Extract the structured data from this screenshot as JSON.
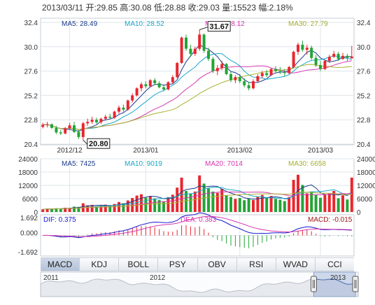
{
  "header": {
    "date": "2013/03/11",
    "items": [
      {
        "label": "开",
        "value": "29.85"
      },
      {
        "label": "高",
        "value": "30.08"
      },
      {
        "label": "低",
        "value": "28.88"
      },
      {
        "label": "收",
        "value": "29.03"
      },
      {
        "label": "量",
        "value": "15523"
      },
      {
        "label": "幅",
        "value": "2.18%"
      }
    ]
  },
  "colors": {
    "up": "#e8262e",
    "down": "#23a435",
    "ma5": "#1a3a8c",
    "ma10": "#18a8c8",
    "ma20": "#d836b0",
    "ma30": "#a8b030",
    "grid": "#dfe4ea",
    "frame": "#c6ccd5",
    "dif": "#1a1ad0",
    "dea": "#d836b0"
  },
  "tabs": [
    "MACD",
    "KDJ",
    "BOLL",
    "PSY",
    "OBV",
    "RSI",
    "WVAD",
    "CCI"
  ],
  "active_tab": "MACD",
  "chart_data": [
    {
      "type": "candlestick",
      "ma_legend": [
        {
          "name": "MA5",
          "value": "28.49"
        },
        {
          "name": "MA10",
          "value": "28.52"
        },
        {
          "name": "MA20",
          "value": "28.12"
        },
        {
          "name": "MA30",
          "value": "27.79"
        }
      ],
      "y_ticks": [
        "32.4",
        "30.0",
        "27.6",
        "25.2",
        "22.8",
        "20.4"
      ],
      "ylim": [
        20.4,
        32.4
      ],
      "x_ticks": [
        {
          "label": "2012/12",
          "index": 6
        },
        {
          "label": "2013/01",
          "index": 23
        },
        {
          "label": "2013/02",
          "index": 44
        },
        {
          "label": "2013/03",
          "index": 62
        }
      ],
      "annotations": [
        {
          "text": "31.67",
          "index": 35,
          "price": 31.67
        },
        {
          "text": "20.80",
          "index": 9,
          "price": 20.8
        }
      ],
      "ohlc": [
        [
          22.1,
          22.5,
          21.95,
          22.3
        ],
        [
          22.3,
          22.6,
          22.05,
          22.35
        ],
        [
          22.35,
          22.45,
          21.9,
          22.0
        ],
        [
          22.0,
          22.2,
          21.4,
          21.55
        ],
        [
          21.55,
          21.8,
          21.3,
          21.45
        ],
        [
          21.45,
          22.1,
          21.35,
          21.95
        ],
        [
          21.95,
          22.5,
          21.8,
          22.25
        ],
        [
          22.25,
          22.6,
          21.5,
          21.6
        ],
        [
          21.6,
          21.8,
          20.9,
          21.1
        ],
        [
          21.1,
          22.6,
          20.8,
          22.45
        ],
        [
          22.45,
          22.9,
          22.2,
          22.6
        ],
        [
          22.6,
          23.1,
          22.4,
          22.8
        ],
        [
          22.8,
          23.0,
          22.4,
          22.55
        ],
        [
          22.55,
          23.0,
          22.4,
          22.9
        ],
        [
          22.9,
          23.3,
          22.7,
          23.1
        ],
        [
          23.1,
          23.4,
          22.9,
          23.0
        ],
        [
          23.0,
          23.7,
          22.9,
          23.6
        ],
        [
          23.6,
          24.2,
          23.4,
          24.0
        ],
        [
          24.0,
          24.3,
          23.6,
          23.8
        ],
        [
          23.8,
          24.8,
          23.7,
          24.7
        ],
        [
          24.7,
          25.4,
          24.5,
          25.2
        ],
        [
          25.2,
          26.0,
          25.1,
          25.9
        ],
        [
          25.9,
          26.5,
          25.6,
          26.3
        ],
        [
          26.3,
          26.6,
          25.9,
          26.1
        ],
        [
          26.1,
          26.8,
          26.0,
          26.7
        ],
        [
          26.7,
          26.9,
          26.2,
          26.4
        ],
        [
          26.4,
          26.6,
          25.9,
          26.0
        ],
        [
          26.0,
          26.3,
          25.6,
          25.8
        ],
        [
          25.8,
          26.6,
          25.7,
          26.5
        ],
        [
          26.5,
          27.2,
          26.3,
          27.0
        ],
        [
          27.0,
          28.5,
          26.9,
          28.4
        ],
        [
          28.4,
          31.0,
          28.3,
          30.9
        ],
        [
          30.9,
          31.2,
          29.6,
          29.8
        ],
        [
          29.8,
          30.2,
          29.0,
          29.3
        ],
        [
          29.3,
          30.0,
          29.1,
          29.8
        ],
        [
          29.8,
          31.67,
          29.6,
          31.2
        ],
        [
          31.2,
          31.3,
          29.4,
          29.6
        ],
        [
          29.6,
          29.9,
          28.6,
          28.8
        ],
        [
          28.8,
          29.0,
          27.4,
          27.6
        ],
        [
          27.6,
          28.2,
          27.2,
          27.9
        ],
        [
          27.9,
          28.6,
          27.7,
          28.3
        ],
        [
          28.3,
          28.4,
          27.2,
          27.3
        ],
        [
          27.3,
          27.5,
          26.5,
          26.7
        ],
        [
          26.7,
          27.2,
          26.4,
          27.0
        ],
        [
          27.0,
          27.3,
          26.4,
          26.6
        ],
        [
          26.6,
          26.9,
          26.0,
          26.2
        ],
        [
          26.2,
          26.5,
          25.7,
          25.9
        ],
        [
          25.9,
          26.8,
          25.8,
          26.6
        ],
        [
          26.6,
          27.3,
          26.5,
          27.1
        ],
        [
          27.1,
          27.6,
          26.9,
          27.4
        ],
        [
          27.4,
          27.7,
          27.0,
          27.2
        ],
        [
          27.2,
          27.9,
          27.1,
          27.8
        ],
        [
          27.8,
          28.1,
          27.4,
          27.6
        ],
        [
          27.6,
          28.0,
          27.3,
          27.5
        ],
        [
          27.5,
          27.8,
          27.1,
          27.4
        ],
        [
          27.4,
          28.1,
          27.3,
          28.0
        ],
        [
          28.0,
          29.6,
          27.9,
          29.5
        ],
        [
          29.5,
          30.4,
          29.2,
          30.2
        ],
        [
          30.2,
          30.6,
          29.5,
          29.7
        ],
        [
          29.7,
          30.2,
          29.2,
          29.9
        ],
        [
          29.9,
          30.1,
          28.7,
          28.9
        ],
        [
          28.9,
          29.2,
          28.0,
          28.2
        ],
        [
          28.2,
          28.6,
          27.6,
          27.8
        ],
        [
          27.8,
          28.7,
          27.7,
          28.6
        ],
        [
          28.6,
          29.2,
          28.4,
          29.0
        ],
        [
          29.0,
          29.6,
          28.9,
          29.3
        ],
        [
          29.3,
          29.5,
          28.6,
          28.8
        ],
        [
          28.8,
          29.4,
          28.7,
          29.1
        ],
        [
          29.1,
          29.3,
          28.6,
          28.9
        ],
        [
          28.85,
          30.08,
          28.88,
          29.03
        ]
      ]
    },
    {
      "type": "bar",
      "ma_legend": [
        {
          "name": "MA5",
          "value": "7425"
        },
        {
          "name": "MA10",
          "value": "9019"
        },
        {
          "name": "MA20",
          "value": "7014"
        },
        {
          "name": "MA30",
          "value": "6658"
        }
      ],
      "y_ticks": [
        "24000",
        "18000",
        "12000",
        "6000",
        "0"
      ],
      "ylim": [
        0,
        24000
      ],
      "volume": [
        1200,
        1500,
        1300,
        1700,
        1600,
        1900,
        1800,
        2400,
        2300,
        3900,
        3000,
        3200,
        2500,
        2800,
        3300,
        2700,
        3600,
        4500,
        3900,
        5200,
        6300,
        7400,
        8000,
        6400,
        7200,
        6100,
        5400,
        4800,
        6700,
        7800,
        11000,
        15500,
        9500,
        8300,
        9200,
        16500,
        12800,
        10600,
        9200,
        8600,
        10400,
        7600,
        6800,
        5900,
        6300,
        5300,
        6000,
        5400,
        6900,
        7700,
        6400,
        7200,
        5900,
        5500,
        4900,
        6700,
        14500,
        16800,
        12200,
        8400,
        9200,
        7600,
        6400,
        7900,
        8300,
        9500,
        6200,
        7500,
        5600,
        15523
      ]
    },
    {
      "type": "line",
      "legend": [
        {
          "name": "DIF",
          "value": "0.375"
        },
        {
          "name": "DEA",
          "value": "0.383"
        },
        {
          "name": "MACD",
          "value": "-0.015"
        }
      ],
      "y_ticks": [
        "1.692",
        "0.000",
        "-1.692"
      ],
      "ylim": [
        -1.692,
        1.692
      ]
    },
    {
      "type": "area",
      "x_labels": [
        "2011",
        "2012",
        "2013"
      ],
      "range_selected": [
        0.86,
        1.0
      ]
    }
  ]
}
